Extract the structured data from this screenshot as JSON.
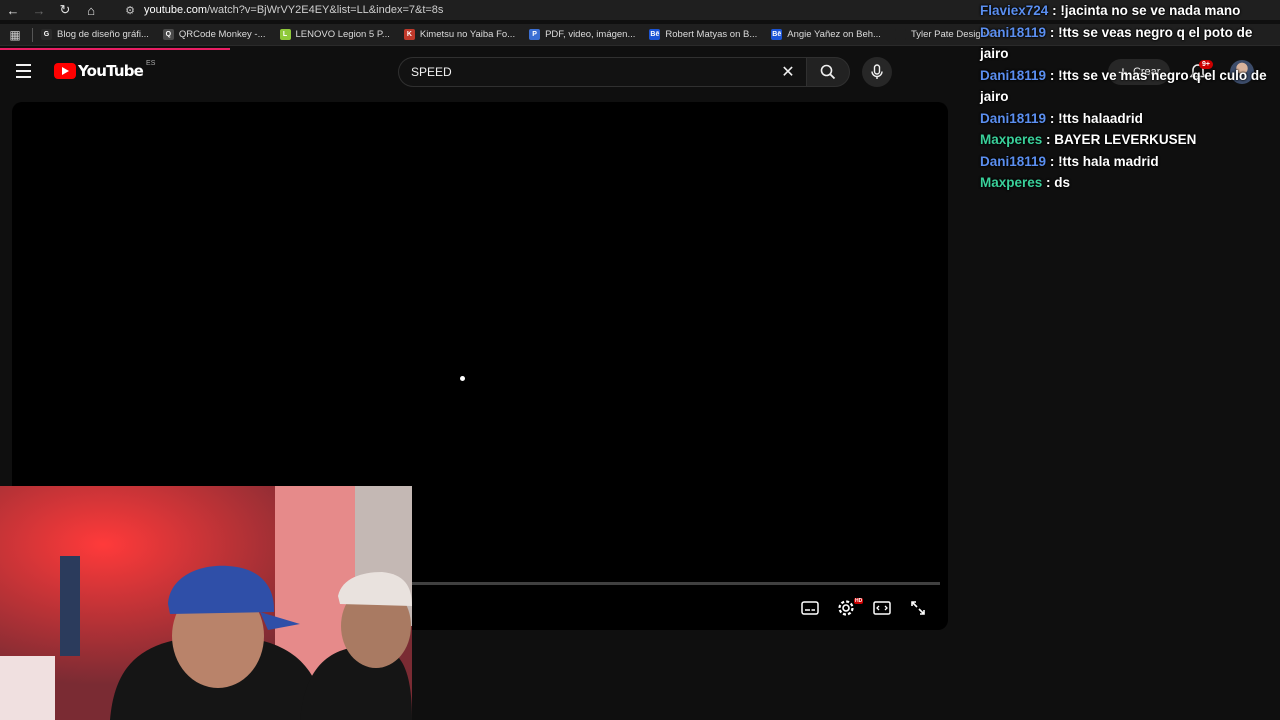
{
  "browser": {
    "url_host": "youtube.com",
    "url_path": "/watch?v=BjWrVY2E4EY&list=LL&index=7&t=8s",
    "bookmarks": [
      {
        "label": "Blog de diseño gráfi...",
        "color": "#2a2a2a",
        "glyph": "G"
      },
      {
        "label": "QRCode Monkey -...",
        "color": "#4a4a4a",
        "glyph": "Q"
      },
      {
        "label": "LENOVO Legion 5 P...",
        "color": "#8fc93a",
        "glyph": "L"
      },
      {
        "label": "Kimetsu no Yaiba Fo...",
        "color": "#c0392b",
        "glyph": "K"
      },
      {
        "label": "PDF, video, imágen...",
        "color": "#3b6fd4",
        "glyph": "P"
      },
      {
        "label": "Robert Matyas on B...",
        "color": "#1b54d6",
        "glyph": "Bē"
      },
      {
        "label": "Angie Yañez on Beh...",
        "color": "#1b54d6",
        "glyph": "Bē"
      },
      {
        "label": "Tyler Pate Design Co",
        "color": "#1f1f1f",
        "glyph": ""
      }
    ]
  },
  "youtube": {
    "logo_text": "YouTube",
    "region": "ES",
    "search_value": "SPEED",
    "create_label": "Crear",
    "notifications_badge": "9+"
  },
  "chat": [
    {
      "user": "Flaviex724",
      "text": "!jacinta no se ve nada mano",
      "color": "#5b8ff0"
    },
    {
      "user": "Dani18119",
      "text": "!tts se veas negro q el poto de jairo",
      "color": "#5b8ff0"
    },
    {
      "user": "Dani18119",
      "text": "!tts se ve mas negro q el culo de jairo",
      "color": "#5b8ff0"
    },
    {
      "user": "Dani18119",
      "text": "!tts halaadrid",
      "color": "#5b8ff0"
    },
    {
      "user": "Maxperes",
      "text": "BAYER LEVERKUSEN",
      "color": "#3ad09a"
    },
    {
      "user": "Dani18119",
      "text": "!tts hala madrid",
      "color": "#5b8ff0"
    },
    {
      "user": "Maxperes",
      "text": "ds",
      "color": "#3ad09a"
    }
  ],
  "colors": {
    "brand_red": "#ff0000",
    "accent_bar": "#e91e63"
  }
}
